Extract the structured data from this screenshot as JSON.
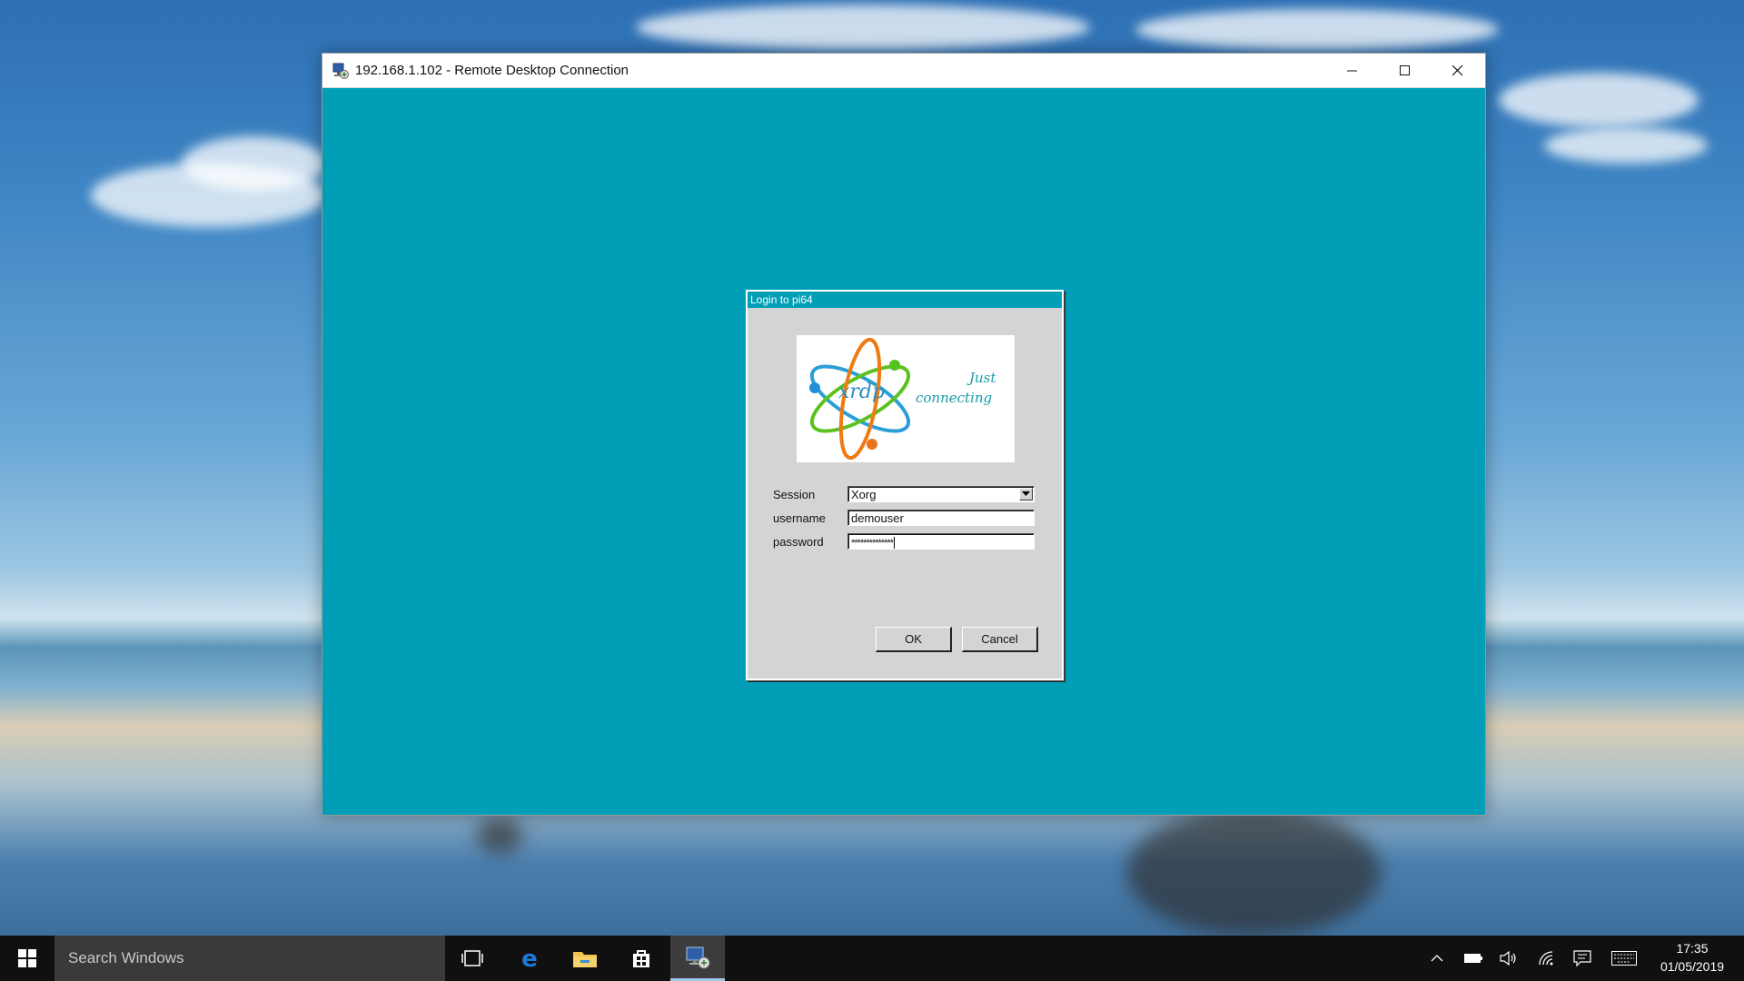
{
  "window": {
    "title": "192.168.1.102 - Remote Desktop Connection",
    "app_icon": "remote-desktop-icon",
    "controls": [
      "minimize-icon",
      "maximize-icon",
      "close-icon"
    ],
    "remote_background_color": "#009fb7"
  },
  "login": {
    "title": "Login to pi64",
    "logo": {
      "brand": "xrdp",
      "tagline_line1": "Just",
      "tagline_line2": "connecting"
    },
    "fields": {
      "session_label": "Session",
      "session_value": "Xorg",
      "username_label": "username",
      "username_value": "demouser",
      "password_label": "password",
      "password_value": "**************"
    },
    "ok_label": "OK",
    "cancel_label": "Cancel"
  },
  "taskbar": {
    "search_placeholder": "Search Windows",
    "pinned": [
      "task-view-icon",
      "edge-icon",
      "file-explorer-icon",
      "store-icon",
      "remote-desktop-icon"
    ],
    "tray": [
      "chevron-up-icon",
      "battery-icon",
      "volume-icon",
      "wifi-icon",
      "notification-icon",
      "keyboard-icon"
    ],
    "time": "17:35",
    "date": "01/05/2019"
  },
  "colors": {
    "accent_teal": "#009fb7",
    "dialog_gray": "#d4d4d4",
    "taskbar": "#101010"
  }
}
